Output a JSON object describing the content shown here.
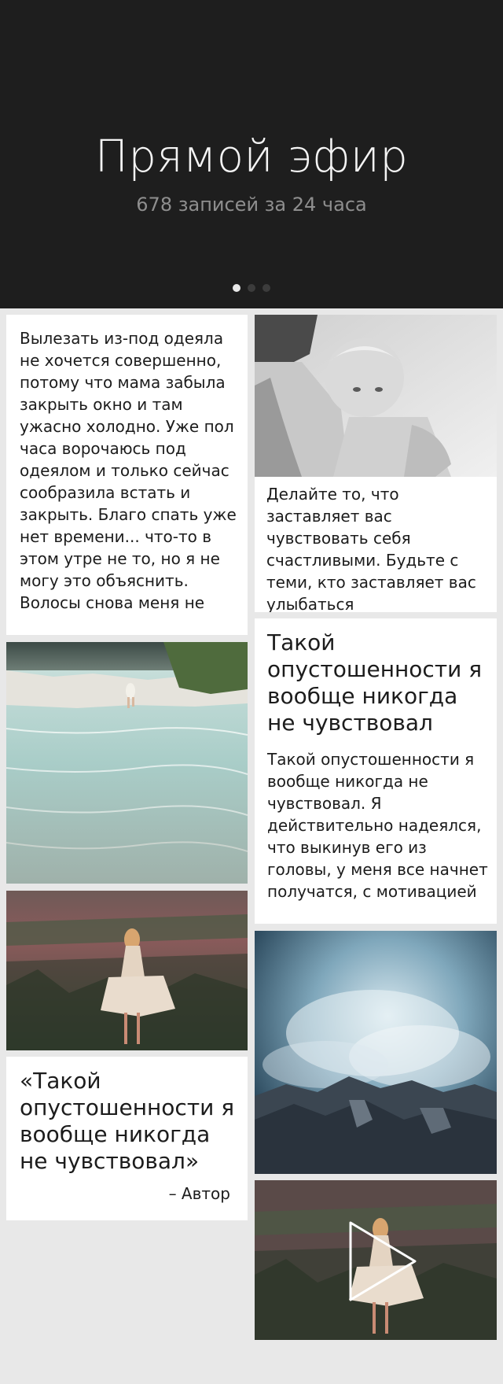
{
  "hero": {
    "title": "Прямой эфир",
    "subtitle": "678 записей за 24 часа",
    "dots": {
      "count": 3,
      "active_index": 0
    }
  },
  "cards": {
    "text_post": {
      "text": "Вылезать из-под одеяла не хочется совершенно, потому что мама забыла закрыть окно и там ужасно холодно. Уже пол часа ворочаюсь под одеялом и только сейчас сообразила встать и закрыть. Благо спать уже нет времени... что-то в этом утре не то, но я не могу это объяснить. Волосы снова меня не"
    },
    "photo_caption_post": {
      "image_icon": "mother-child-photo",
      "caption": "Делайте то, что заставляет вас чувствовать себя счастливыми. Будьте с теми, кто заставляет вас улыбаться"
    },
    "titled_post": {
      "title": "Такой опустошенности я вообще никогда не чувствовал",
      "text": "Такой опустошенности я вообще никогда не чувствовал. Я действительно надеялся, что выкинув его из головы, у меня все начнет получатся, с мотивацией"
    },
    "quote_post": {
      "quote": "«Такой опустошенности я вообще никогда не чувствовал»",
      "author": "– Автор"
    },
    "photos": {
      "river": "river-photo",
      "field_girl": "field-girl-photo",
      "mountains": "mountains-clouds-photo",
      "video": "video-thumbnail"
    }
  },
  "icons": {
    "play": "play-icon"
  },
  "colors": {
    "hero_bg": "#1e1e1e",
    "page_bg": "#e8e8e8",
    "card_bg": "#ffffff",
    "text": "#1c1c1c",
    "subtitle": "#8e8e8e"
  }
}
